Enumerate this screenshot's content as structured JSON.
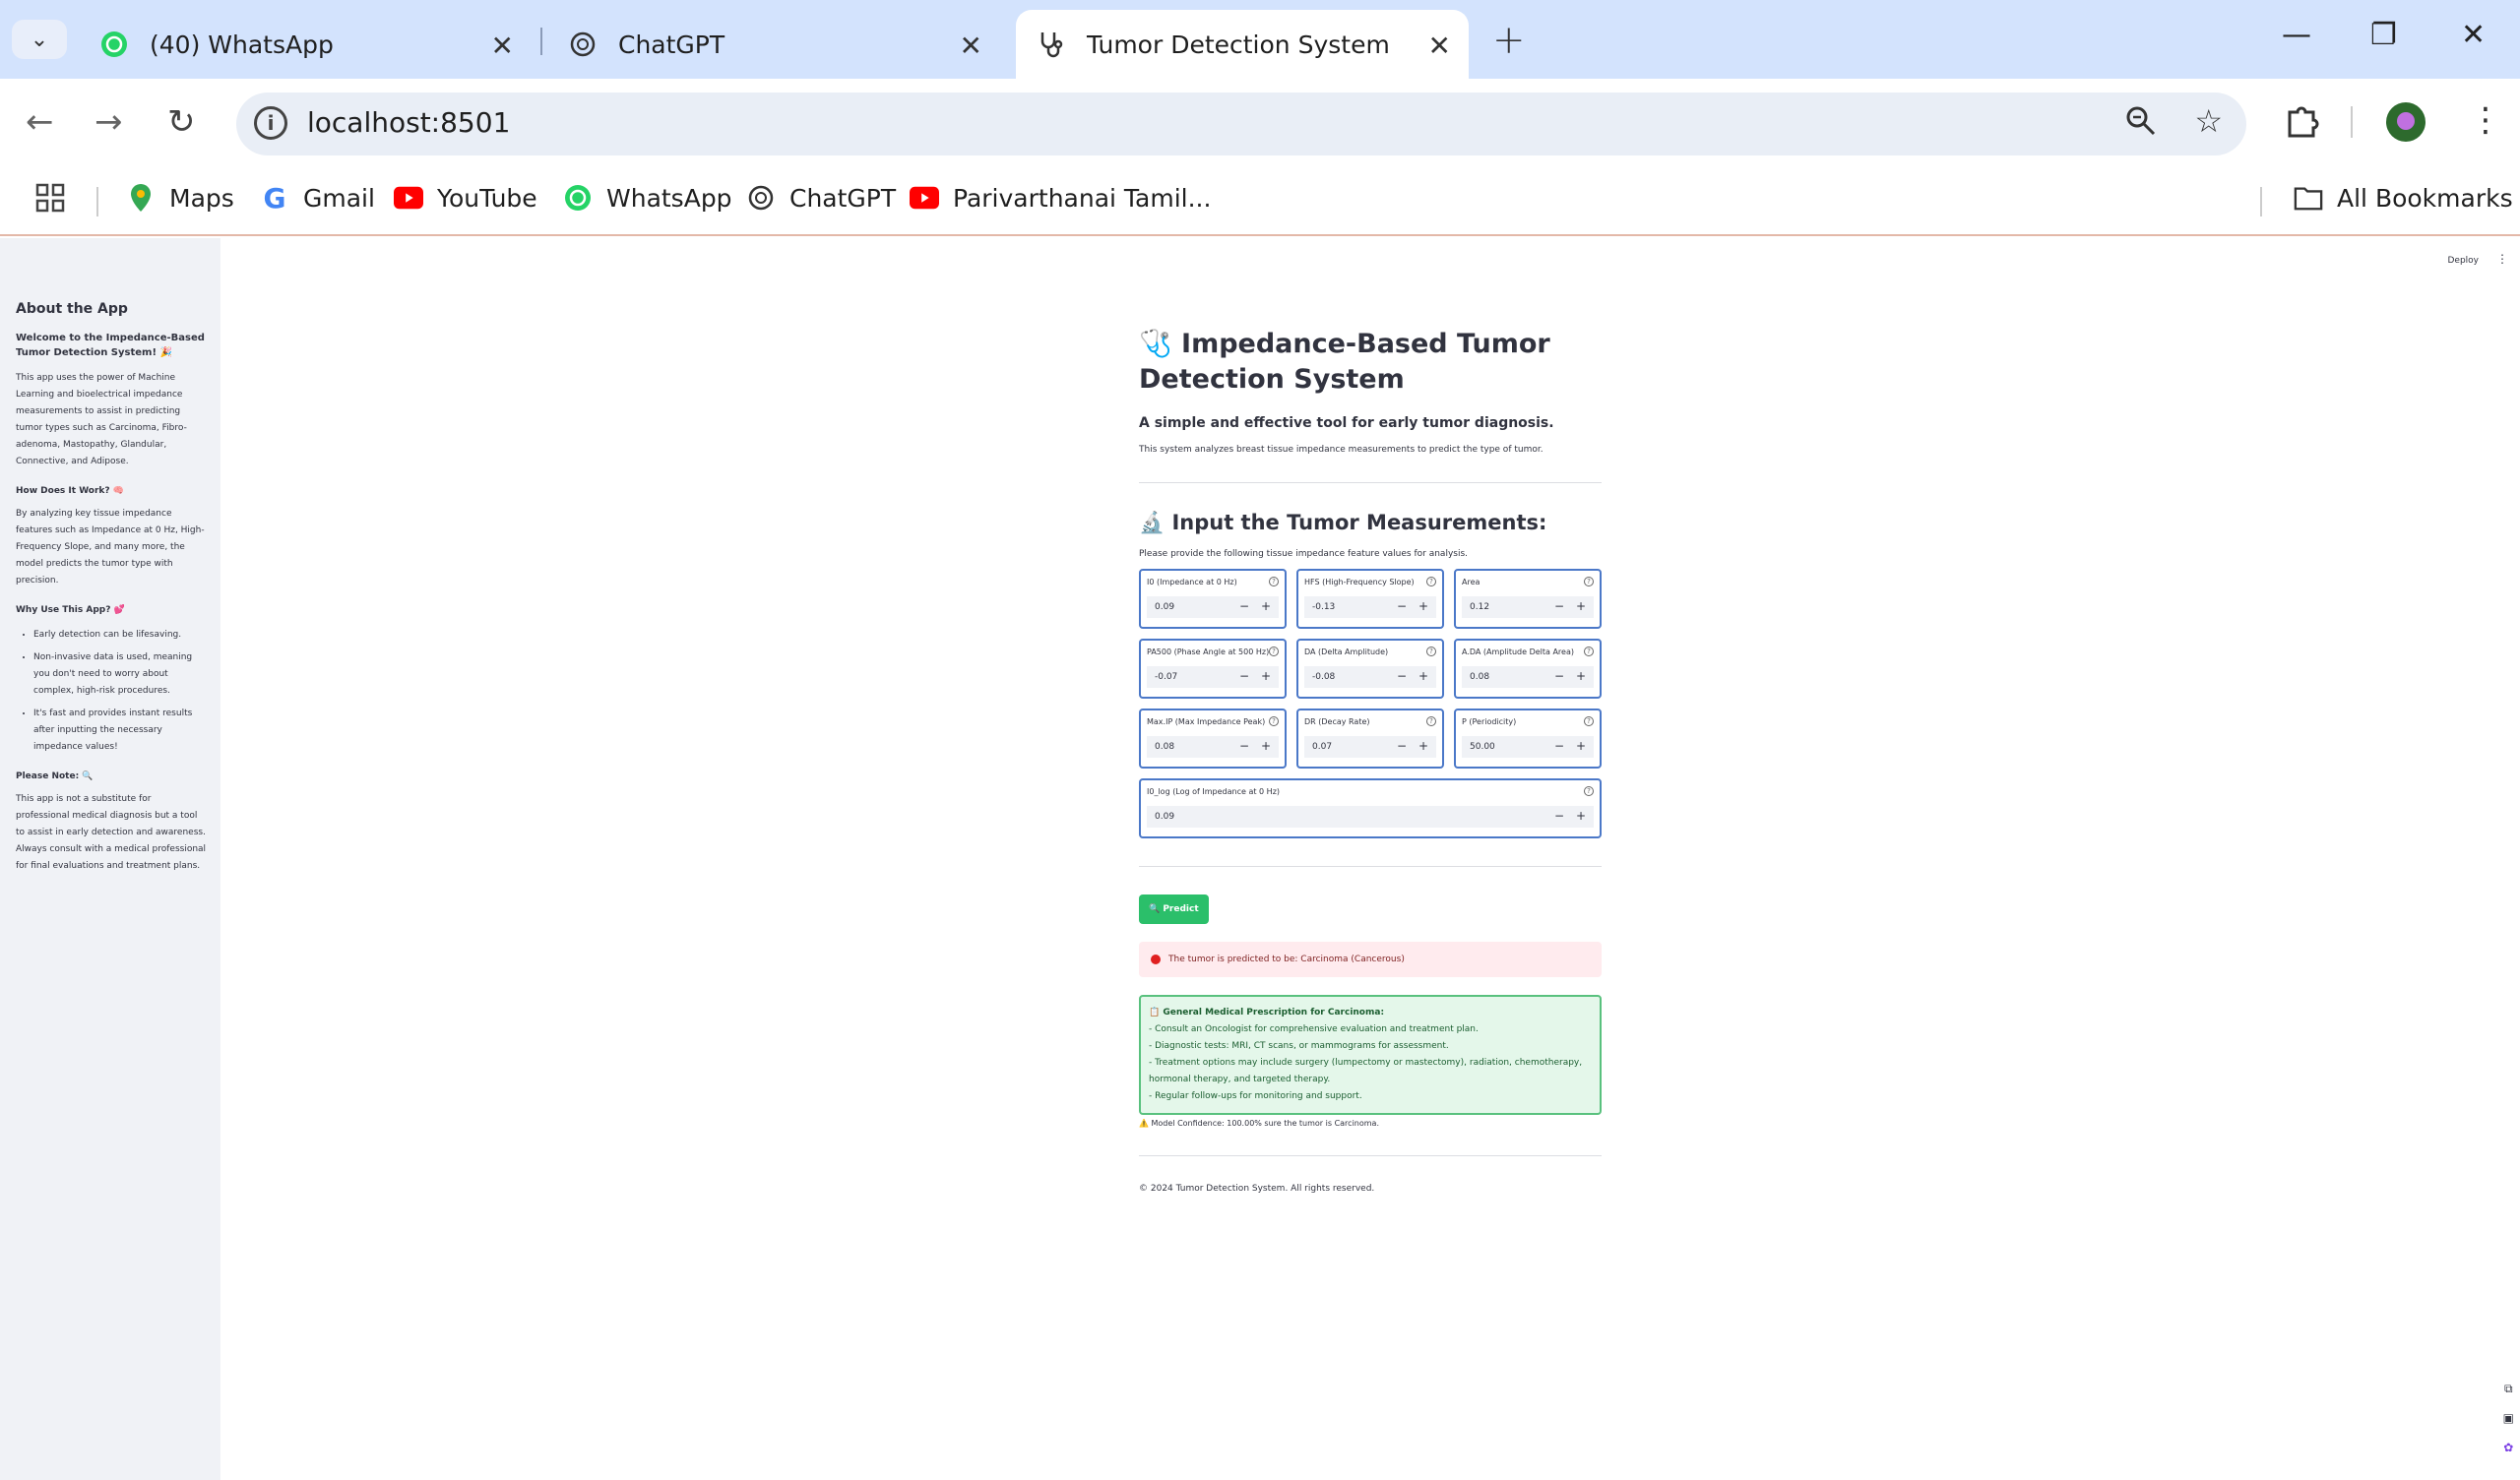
{
  "browser": {
    "tabs": [
      {
        "label": "(40) WhatsApp"
      },
      {
        "label": "ChatGPT"
      },
      {
        "label": "Tumor Detection System"
      }
    ],
    "url": "localhost:8501",
    "bookmarks": [
      "Maps",
      "Gmail",
      "YouTube",
      "WhatsApp",
      "ChatGPT",
      "Parivarthanai Tamil..."
    ],
    "all_bookmarks": "All Bookmarks"
  },
  "app": {
    "deploy": "Deploy",
    "sidebar": {
      "title": "About the App",
      "welcome": "Welcome to the Impedance-Based Tumor Detection System! 🎉",
      "intro": "This app uses the power of Machine Learning and bioelectrical impedance measurements to assist in predicting tumor types such as Carcinoma, Fibro-adenoma, Mastopathy, Glandular, Connective, and Adipose.",
      "how_title": "How Does It Work? 🧠",
      "how_text": "By analyzing key tissue impedance features such as Impedance at 0 Hz, High-Frequency Slope, and many more, the model predicts the tumor type with precision.",
      "why_title": "Why Use This App? 💕",
      "why_items": [
        "Early detection can be lifesaving.",
        "Non-invasive data is used, meaning you don't need to worry about complex, high-risk procedures.",
        "It's fast and provides instant results after inputting the necessary impedance values!"
      ],
      "note_title": "Please Note: 🔍",
      "note_text": "This app is not a substitute for professional medical diagnosis but a tool to assist in early detection and awareness. Always consult with a medical professional for final evaluations and treatment plans."
    },
    "title": "🩺 Impedance-Based Tumor Detection System",
    "tagline": "A simple and effective tool for early tumor diagnosis.",
    "description": "This system analyzes breast tissue impedance measurements to predict the type of tumor.",
    "input_heading": "🔬 Input the Tumor Measurements:",
    "input_instructions": "Please provide the following tissue impedance feature values for analysis.",
    "fields": [
      {
        "label": "I0 (Impedance at 0 Hz)",
        "value": "0.09"
      },
      {
        "label": "HFS (High-Frequency Slope)",
        "value": "-0.13"
      },
      {
        "label": "Area",
        "value": "0.12"
      },
      {
        "label": "PA500 (Phase Angle at 500 Hz)",
        "value": "-0.07"
      },
      {
        "label": "DA (Delta Amplitude)",
        "value": "-0.08"
      },
      {
        "label": "A.DA (Amplitude Delta Area)",
        "value": "0.08"
      },
      {
        "label": "Max.IP (Max Impedance Peak)",
        "value": "0.08"
      },
      {
        "label": "DR (Decay Rate)",
        "value": "0.07"
      },
      {
        "label": "P (Periodicity)",
        "value": "50.00"
      },
      {
        "label": "I0_log (Log of Impedance at 0 Hz)",
        "value": "0.09"
      }
    ],
    "predict_label": "🔍 Predict",
    "result": "The tumor is predicted to be: Carcinoma (Cancerous)",
    "prescription": {
      "title": "📋 General Medical Prescription for Carcinoma:",
      "lines": [
        "- Consult an Oncologist for comprehensive evaluation and treatment plan.",
        "- Diagnostic tests: MRI, CT scans, or mammograms for assessment.",
        "- Treatment options may include surgery (lumpectomy or mastectomy), radiation, chemotherapy, hormonal therapy, and targeted therapy.",
        "- Regular follow-ups for monitoring and support."
      ]
    },
    "confidence": "⚠️ Model Confidence: 100.00% sure the tumor is Carcinoma.",
    "footer": "© 2024 Tumor Detection System. All rights reserved."
  }
}
